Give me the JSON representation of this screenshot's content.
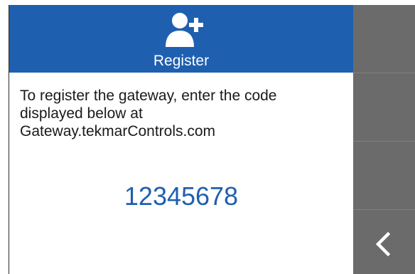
{
  "header": {
    "title": "Register",
    "icon": "add-user-icon",
    "background_color": "#1f5fb0"
  },
  "content": {
    "instruction_lines": [
      "To register the gateway, enter the code",
      "displayed below at",
      "Gateway.tekmarControls.com"
    ],
    "code": "12345678",
    "code_color": "#1f5fb0"
  },
  "sidebar": {
    "background_color": "#6b6b6b",
    "buttons": [
      {
        "icon": ""
      },
      {
        "icon": ""
      },
      {
        "icon": ""
      },
      {
        "icon": "back-chevron-icon"
      }
    ]
  }
}
